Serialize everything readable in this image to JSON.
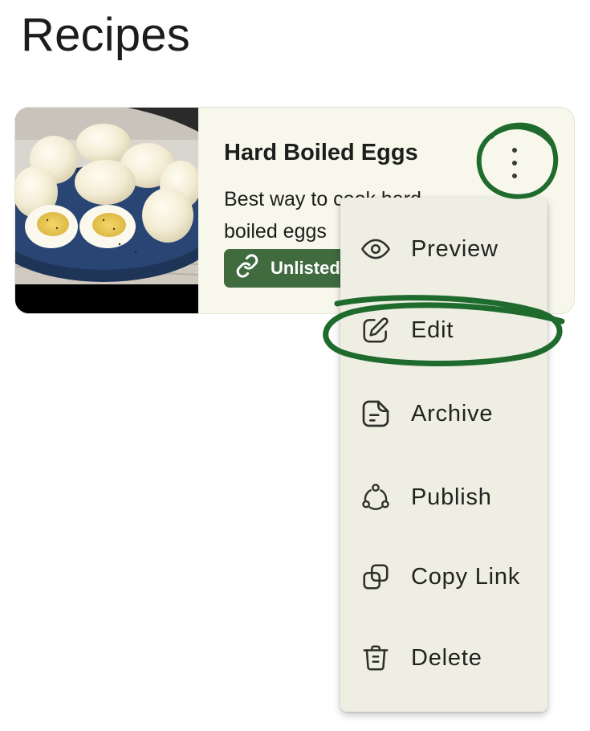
{
  "page": {
    "title": "Recipes"
  },
  "recipe_card": {
    "title": "Hard Boiled Eggs",
    "description": "Best way to cook hard boiled eggs",
    "badge_label": "Unlisted",
    "image_subject": "plate of peeled hard boiled eggs"
  },
  "menu": {
    "items": [
      {
        "label": "Preview",
        "icon": "eye-icon"
      },
      {
        "label": "Edit",
        "icon": "pencil-icon"
      },
      {
        "label": "Archive",
        "icon": "archive-note-icon"
      },
      {
        "label": "Publish",
        "icon": "share-network-icon"
      },
      {
        "label": "Copy Link",
        "icon": "copy-icon"
      },
      {
        "label": "Delete",
        "icon": "trash-icon"
      }
    ]
  },
  "colors": {
    "card_background": "#f8f7ec",
    "menu_background": "#efeee3",
    "badge_background": "#3f6b3f",
    "annotation_green": "#1f6b2e"
  }
}
